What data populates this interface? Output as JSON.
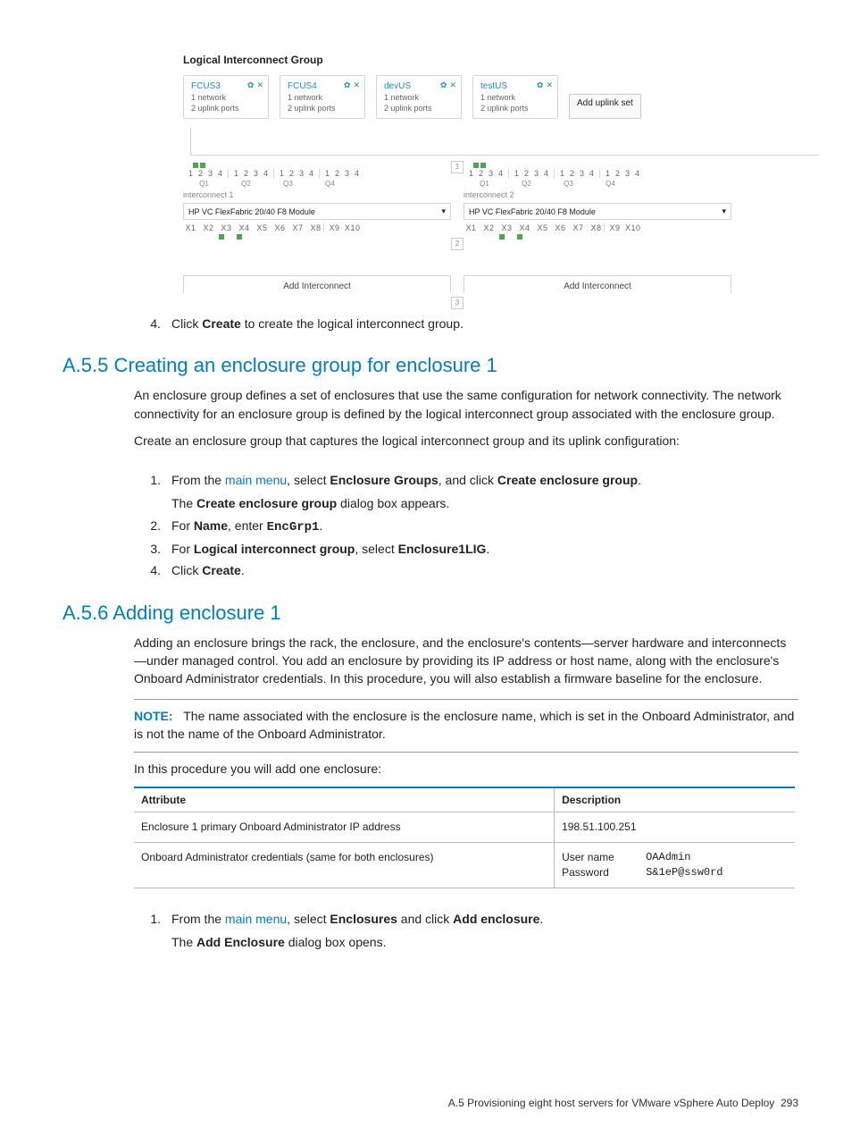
{
  "diagram": {
    "title": "Logical Interconnect Group",
    "uplink_cards": [
      {
        "name": "FCUS3",
        "l2": "1 network",
        "l3": "2 uplink ports"
      },
      {
        "name": "FCUS4",
        "l2": "1 network",
        "l3": "2 uplink ports"
      },
      {
        "name": "devUS",
        "l2": "1 network",
        "l3": "2 uplink ports"
      },
      {
        "name": "testUS",
        "l2": "1 network",
        "l3": "2 uplink ports"
      }
    ],
    "add_uplink_label": "Add uplink set",
    "module_select_label": "HP VC FlexFabric 20/40 F8 Module",
    "interconnect_labels": [
      "interconnect 1",
      "interconnect 2"
    ],
    "q_labels": [
      "Q1",
      "Q2",
      "Q3",
      "Q4"
    ],
    "port_nums": [
      "1",
      "2",
      "3",
      "4"
    ],
    "x_labels": [
      "X1",
      "X2",
      "X3",
      "X4",
      "X5",
      "X6",
      "X7",
      "X8",
      "X9",
      "X10"
    ],
    "slot_nums": [
      "1",
      "2",
      "3"
    ],
    "add_interconnect_label": "Add Interconnect"
  },
  "step4": {
    "num": "4.",
    "text_pre": "Click ",
    "bold": "Create",
    "text_post": " to create the logical interconnect group."
  },
  "sec_a55": {
    "heading": "A.5.5 Creating an enclosure group for enclosure 1",
    "para1": "An enclosure group defines a set of enclosures that use the same configuration for network connectivity. The network connectivity for an enclosure group is defined by the logical interconnect group associated with the enclosure group.",
    "para2": "Create an enclosure group that captures the logical interconnect group and its uplink configuration:",
    "steps": [
      {
        "num": "1.",
        "html": "From the <span class='link'>main menu</span>, select <strong>Enclosure Groups</strong>, and click <strong>Create enclosure group</strong>.",
        "sub": "The <strong>Create enclosure group</strong> dialog box appears."
      },
      {
        "num": "2.",
        "html": "For <strong>Name</strong>, enter <span class='mono'><strong>EncGrp1</strong></span>."
      },
      {
        "num": "3.",
        "html": "For <strong>Logical interconnect group</strong>, select <strong>Enclosure1LIG</strong>."
      },
      {
        "num": "4.",
        "html": "Click <strong>Create</strong>."
      }
    ]
  },
  "sec_a56": {
    "heading": "A.5.6 Adding enclosure 1",
    "para1": "Adding an enclosure brings the rack, the enclosure, and the enclosure's contents—server hardware and interconnects—under managed control. You add an enclosure by providing its IP address or host name, along with the enclosure's Onboard Administrator credentials. In this procedure, you will also establish a firmware baseline for the enclosure.",
    "note_label": "NOTE:",
    "note_body": "The name associated with the enclosure is the enclosure name, which is set in the Onboard Administrator, and is not the name of the Onboard Administrator.",
    "para2": "In this procedure you will add one enclosure:",
    "table": {
      "headers": [
        "Attribute",
        "Description"
      ],
      "rows": [
        {
          "attr": "Enclosure 1 primary Onboard Administrator IP address",
          "desc": "198.51.100.251"
        },
        {
          "attr": "Onboard Administrator credentials (same for both enclosures)",
          "cred": [
            {
              "k": "User name",
              "v": "OAAdmin"
            },
            {
              "k": "Password",
              "v": "S&1eP@ssw0rd"
            }
          ]
        }
      ]
    },
    "step1": {
      "num": "1.",
      "html": "From the <span class='link'>main menu</span>, select <strong>Enclosures</strong> and click <strong>Add enclosure</strong>.",
      "sub": "The <strong>Add Enclosure</strong> dialog box opens."
    }
  },
  "footer": {
    "text": "A.5 Provisioning eight host servers for VMware vSphere Auto Deploy",
    "page": "293"
  }
}
